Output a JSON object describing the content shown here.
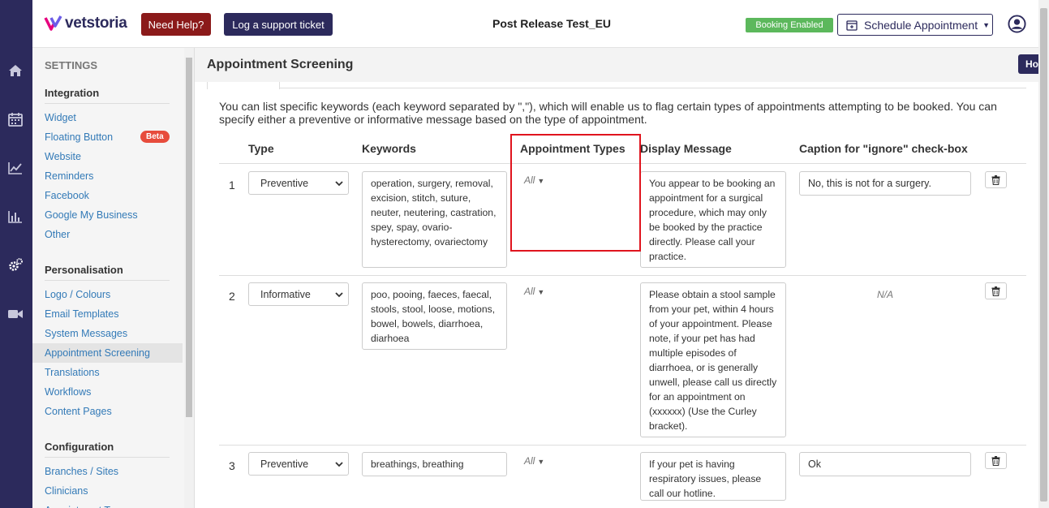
{
  "brand": {
    "logo_text": "vetstoria",
    "accent": "#2c2a5c"
  },
  "header": {
    "help_label": "Need Help?",
    "ticket_label": "Log a support ticket",
    "title": "Post Release Test_EU",
    "booking_status": "Booking Enabled",
    "schedule_label": "Schedule Appointment"
  },
  "rail": {
    "icons": [
      "home-icon",
      "calendar-icon",
      "chart-line-icon",
      "bar-chart-icon",
      "gears-icon",
      "video-icon"
    ]
  },
  "sidebar": {
    "settings_label": "SETTINGS",
    "integration": {
      "heading": "Integration",
      "items": [
        "Widget",
        "Floating Button",
        "Website",
        "Reminders",
        "Facebook",
        "Google My Business",
        "Other"
      ],
      "beta_label": "Beta"
    },
    "personalisation": {
      "heading": "Personalisation",
      "items": [
        "Logo / Colours",
        "Email Templates",
        "System Messages",
        "Appointment Screening",
        "Translations",
        "Workflows",
        "Content Pages"
      ]
    },
    "configuration": {
      "heading": "Configuration",
      "items": [
        "Branches / Sites",
        "Clinicians",
        "Appointment Types"
      ]
    }
  },
  "main": {
    "title": "Appointment Screening",
    "intro": "You can list specific keywords (each keyword separated by \",\"), which will enable us to flag certain types of appointments attempting to be booked. You can specify either a preventive or informative message based on the type of appointment.",
    "columns": {
      "type": "Type",
      "keywords": "Keywords",
      "appointment_types": "Appointment Types",
      "display_message": "Display Message",
      "caption": "Caption for \"ignore\" check-box"
    },
    "rows": [
      {
        "num": "1",
        "type": "Preventive",
        "keywords": "operation, surgery, removal, excision, stitch, suture, neuter, neutering, castration, spey, spay, ovario-hysterectomy, ovariectomy",
        "appointment_types": "All",
        "message": "You appear to be booking an appointment for a surgical procedure, which may only be booked by the practice directly. Please call your practice.",
        "caption": "No, this is not for a surgery."
      },
      {
        "num": "2",
        "type": "Informative",
        "keywords": "poo, pooing, faeces, faecal, stools, stool, loose, motions, bowel, bowels, diarrhoea, diarhoea",
        "appointment_types": "All",
        "message": "Please obtain a stool sample from your pet, within 4 hours of your appointment. Please note, if your pet has had multiple episodes of diarrhoea, or is generally unwell, please call us directly for an appointment on (xxxxxx) (Use the Curley bracket).",
        "caption": "N/A"
      },
      {
        "num": "3",
        "type": "Preventive",
        "keywords": "breathings, breathing",
        "appointment_types": "All",
        "message": "If your pet is having respiratory issues, please call our hotline.",
        "caption": "Ok"
      }
    ]
  },
  "side_tab": {
    "label": "Ho"
  }
}
